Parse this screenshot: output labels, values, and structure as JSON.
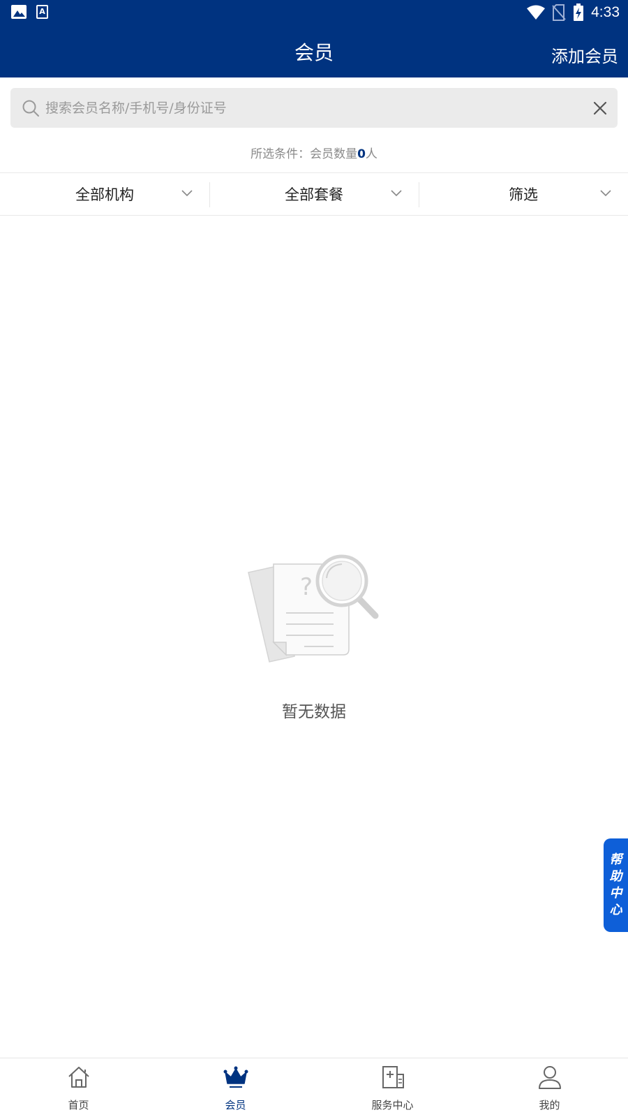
{
  "status_bar": {
    "time": "4:33"
  },
  "header": {
    "title": "会员",
    "add_label": "添加会员"
  },
  "search": {
    "placeholder": "搜索会员名称/手机号/身份证号",
    "value": ""
  },
  "condition": {
    "prefix": "所选条件：会员数量",
    "count": "0",
    "suffix": "人"
  },
  "filters": [
    {
      "label": "全部机构"
    },
    {
      "label": "全部套餐"
    },
    {
      "label": "筛选"
    }
  ],
  "empty": {
    "text": "暂无数据"
  },
  "help": {
    "chars": [
      "帮",
      "助",
      "中",
      "心"
    ]
  },
  "nav": {
    "items": [
      {
        "label": "首页",
        "icon": "home-icon"
      },
      {
        "label": "会员",
        "icon": "crown-icon"
      },
      {
        "label": "服务中心",
        "icon": "service-center-icon"
      },
      {
        "label": "我的",
        "icon": "user-icon"
      }
    ],
    "active_index": 1
  },
  "colors": {
    "brand": "#003380",
    "help": "#0e5fd8",
    "search_bg": "#ebebeb"
  }
}
